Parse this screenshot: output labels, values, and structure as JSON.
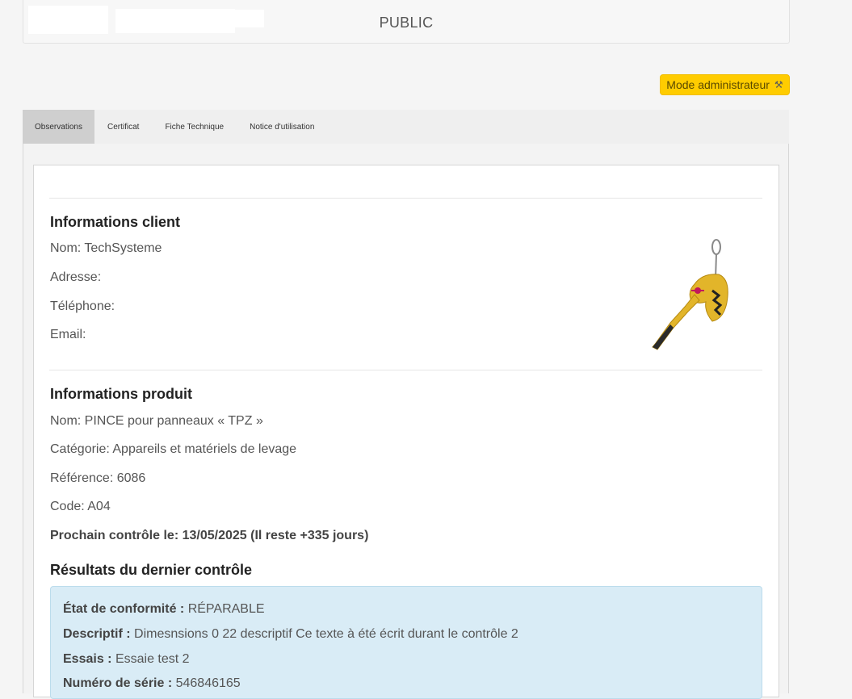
{
  "header": {
    "title": "PUBLIC"
  },
  "admin_button": {
    "label": "Mode administrateur",
    "icon": "hammer-icon"
  },
  "tabs": [
    {
      "label": "Observations",
      "active": true
    },
    {
      "label": "Certificat",
      "active": false
    },
    {
      "label": "Fiche Technique",
      "active": false
    },
    {
      "label": "Notice d'utilisation",
      "active": false
    }
  ],
  "client": {
    "title": "Informations client",
    "nom": "Nom: TechSysteme",
    "adresse": "Adresse:",
    "telephone": "Téléphone:",
    "email": "Email:"
  },
  "product": {
    "title": "Informations produit",
    "nom": "Nom: PINCE pour panneaux « TPZ »",
    "categorie": "Catégorie: Appareils et matériels de levage",
    "reference": "Référence: 6086",
    "code": "Code: A04",
    "prochain": "Prochain contrôle le: 13/05/2025 (Il reste +335 jours)"
  },
  "results": {
    "title": "Résultats du dernier contrôle",
    "etat_label": "État de conformité :",
    "etat_value": "RÉPARABLE",
    "descriptif_label": "Descriptif :",
    "descriptif_value": "Dimesnsions 0 22 descriptif Ce texte à été écrit durant le contrôle 2",
    "essais_label": "Essais :",
    "essais_value": "Essaie test 2",
    "serie_label": "Numéro de série :",
    "serie_value": "546846165"
  },
  "colors": {
    "accent": "#ffcc00",
    "alert_bg": "#d9ecf6"
  }
}
